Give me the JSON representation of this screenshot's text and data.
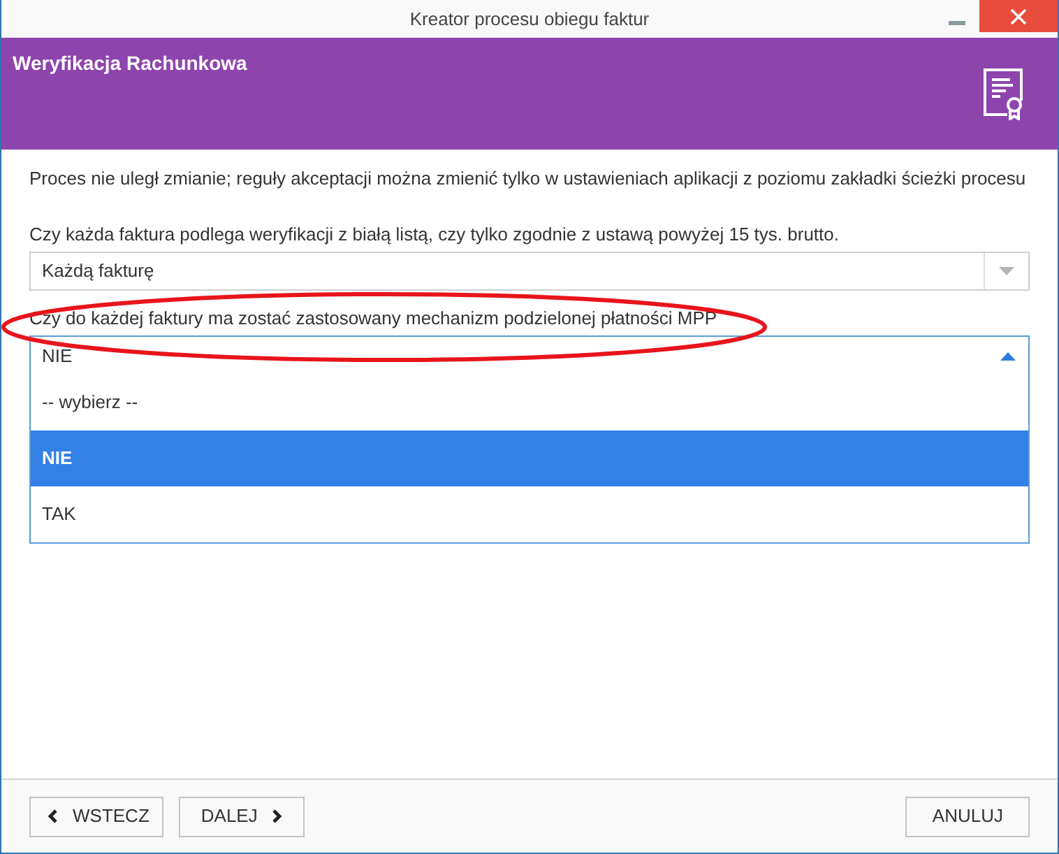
{
  "window": {
    "title": "Kreator procesu obiegu faktur"
  },
  "header": {
    "title": "Weryfikacja Rachunkowa"
  },
  "info_text": "Proces nie uległ zmianie; reguły akceptacji można zmienić tylko w ustawieniach aplikacji z poziomu zakładki ścieżki procesu",
  "fields": [
    {
      "label": "Czy każda faktura podlega weryfikacji z białą listą, czy tylko zgodnie z ustawą powyżej 15 tys. brutto.",
      "value": "Każdą fakturę",
      "expanded": false,
      "highlighted": false
    },
    {
      "label": "Czy do każdej faktury ma zostać zastosowany mechanizm podzielonej płatności MPP",
      "value": "NIE",
      "expanded": true,
      "highlighted": true,
      "options": [
        {
          "label": "-- wybierz --",
          "selected": false
        },
        {
          "label": "NIE",
          "selected": true
        },
        {
          "label": "TAK",
          "selected": false
        }
      ]
    }
  ],
  "buttons": [
    {
      "label": "WSTECZ",
      "kind": "back"
    },
    {
      "label": "DALEJ",
      "kind": "next"
    },
    {
      "label": "ANULUJ",
      "kind": "cancel"
    }
  ]
}
